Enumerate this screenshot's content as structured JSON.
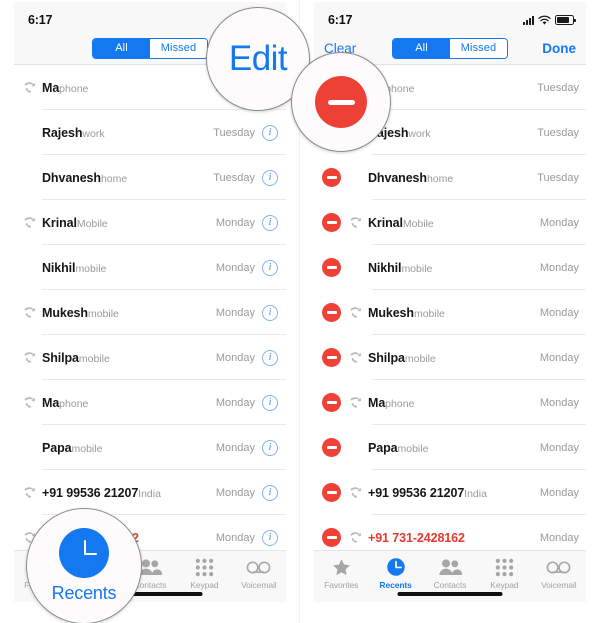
{
  "panels": [
    {
      "id": "left",
      "statusbar": {
        "time": "6:17"
      },
      "navbar": {
        "left_label": "",
        "segments": [
          "All",
          "Missed"
        ],
        "active_segment": "All",
        "right_label": "Edit"
      },
      "edit_mode": false,
      "calls": [
        {
          "name": "Ma",
          "sub": "phone",
          "time": "Tuesday",
          "outgoing": true,
          "missed": false
        },
        {
          "name": "Rajesh",
          "sub": "work",
          "time": "Tuesday",
          "outgoing": false,
          "missed": false
        },
        {
          "name": "Dhvanesh",
          "sub": "home",
          "time": "Tuesday",
          "outgoing": false,
          "missed": false
        },
        {
          "name": "Krinal",
          "sub": "Mobile",
          "time": "Monday",
          "outgoing": true,
          "missed": false
        },
        {
          "name": "Nikhil",
          "sub": "mobile",
          "time": "Monday",
          "outgoing": false,
          "missed": false
        },
        {
          "name": "Mukesh",
          "sub": "mobile",
          "time": "Monday",
          "outgoing": true,
          "missed": false
        },
        {
          "name": "Shilpa",
          "sub": "mobile",
          "time": "Monday",
          "outgoing": true,
          "missed": false
        },
        {
          "name": "Ma",
          "sub": "phone",
          "time": "Monday",
          "outgoing": true,
          "missed": false
        },
        {
          "name": "Papa",
          "sub": "mobile",
          "time": "Monday",
          "outgoing": false,
          "missed": false
        },
        {
          "name": "+91 99536 21207",
          "sub": "India",
          "time": "Monday",
          "outgoing": true,
          "missed": false
        },
        {
          "name": "+91 731-2428162",
          "sub": "",
          "time": "Monday",
          "outgoing": true,
          "missed": true
        }
      ],
      "info_label": "i"
    },
    {
      "id": "right",
      "statusbar": {
        "time": "6:17"
      },
      "navbar": {
        "left_label": "Clear",
        "segments": [
          "All",
          "Missed"
        ],
        "active_segment": "All",
        "right_label": "Done"
      },
      "edit_mode": true,
      "calls": [
        {
          "name": "Ma",
          "sub": "phone",
          "time": "Tuesday",
          "outgoing": true,
          "missed": false
        },
        {
          "name": "Rajesh",
          "sub": "work",
          "time": "Tuesday",
          "outgoing": false,
          "missed": false
        },
        {
          "name": "Dhvanesh",
          "sub": "home",
          "time": "Tuesday",
          "outgoing": false,
          "missed": false
        },
        {
          "name": "Krinal",
          "sub": "Mobile",
          "time": "Monday",
          "outgoing": true,
          "missed": false
        },
        {
          "name": "Nikhil",
          "sub": "mobile",
          "time": "Monday",
          "outgoing": false,
          "missed": false
        },
        {
          "name": "Mukesh",
          "sub": "mobile",
          "time": "Monday",
          "outgoing": true,
          "missed": false
        },
        {
          "name": "Shilpa",
          "sub": "mobile",
          "time": "Monday",
          "outgoing": true,
          "missed": false
        },
        {
          "name": "Ma",
          "sub": "phone",
          "time": "Monday",
          "outgoing": true,
          "missed": false
        },
        {
          "name": "Papa",
          "sub": "mobile",
          "time": "Monday",
          "outgoing": false,
          "missed": false
        },
        {
          "name": "+91 99536 21207",
          "sub": "India",
          "time": "Monday",
          "outgoing": true,
          "missed": false
        },
        {
          "name": "+91 731-2428162",
          "sub": "",
          "time": "Monday",
          "outgoing": true,
          "missed": true
        }
      ],
      "info_label": "i"
    }
  ],
  "tabbar": {
    "tabs": [
      {
        "label": "Favorites",
        "icon": "star-icon",
        "active": false
      },
      {
        "label": "Recents",
        "icon": "clock-icon",
        "active": true
      },
      {
        "label": "Contacts",
        "icon": "people-icon",
        "active": false
      },
      {
        "label": "Keypad",
        "icon": "keypad-icon",
        "active": false
      },
      {
        "label": "Voicemail",
        "icon": "voicemail-icon",
        "active": false
      }
    ]
  },
  "callouts": {
    "edit": "Edit",
    "recents": "Recents",
    "delete_icon": "minus-circle-icon"
  },
  "colors": {
    "accent_blue": "#1478f0",
    "delete_red": "#ee4136",
    "missed_red": "#e8382b",
    "bar_gray": "#f8f8f8"
  }
}
